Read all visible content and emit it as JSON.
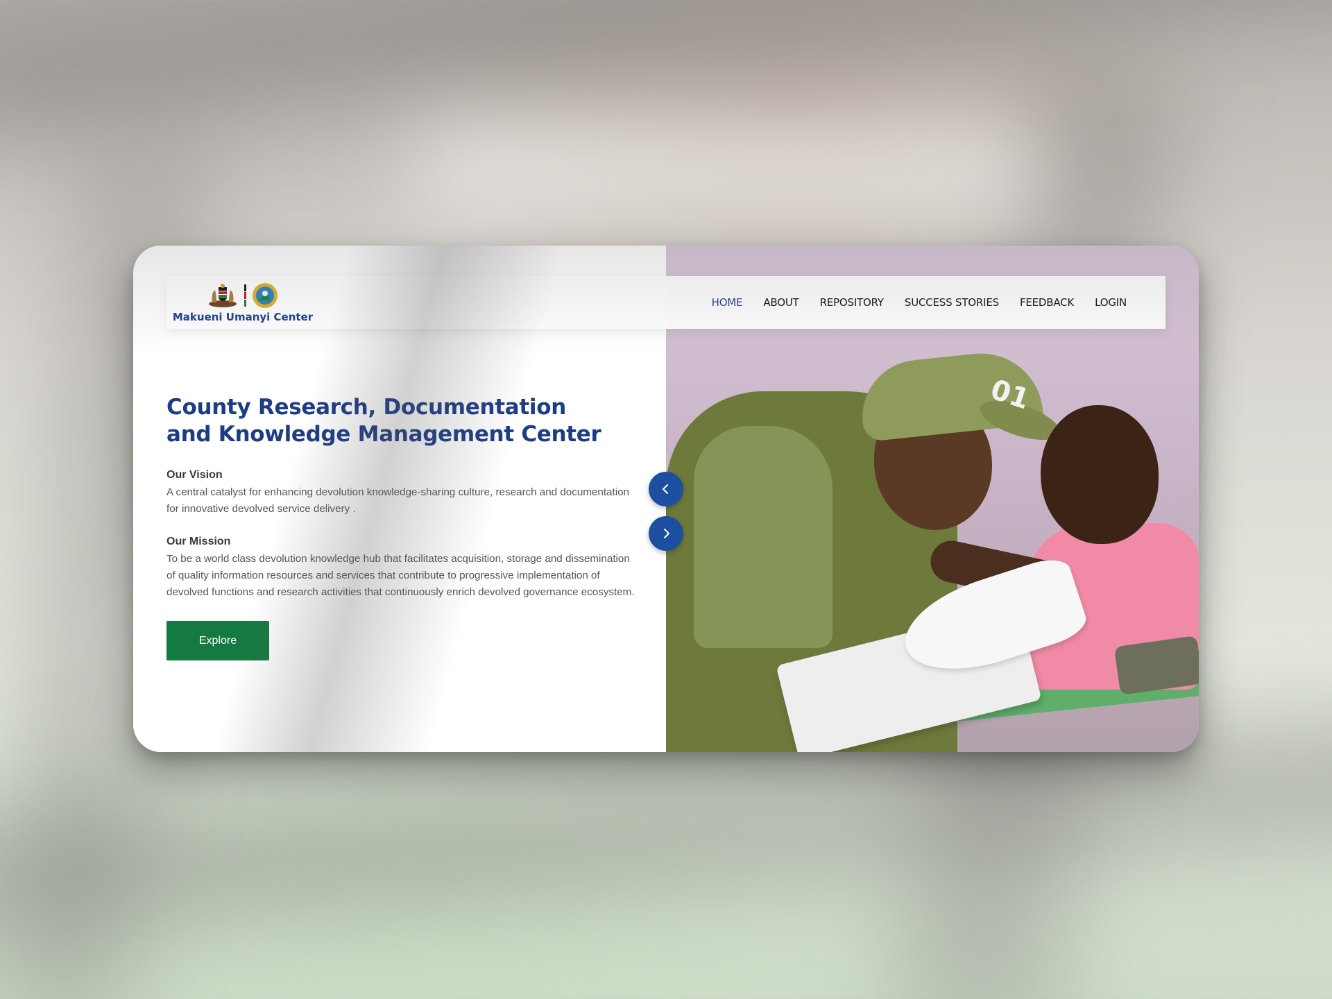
{
  "brand": {
    "name": "Makueni Umanyi Center",
    "emblems": [
      "kenya-coat-of-arms-icon",
      "makueni-county-seal-icon"
    ]
  },
  "nav": {
    "items": [
      {
        "label": "HOME",
        "active": true
      },
      {
        "label": "ABOUT",
        "active": false
      },
      {
        "label": "REPOSITORY",
        "active": false
      },
      {
        "label": "SUCCESS STORIES",
        "active": false
      },
      {
        "label": "FEEDBACK",
        "active": false
      },
      {
        "label": "LOGIN",
        "active": false
      }
    ]
  },
  "hero": {
    "title": "County Research, Documentation and Knowledge Management Center",
    "vision_label": "Our Vision",
    "vision_text": "A central catalyst for enhancing devolution knowledge-sharing culture, research and documentation for innovative devolved service delivery .",
    "mission_label": "Our Mission",
    "mission_text": "To be a world class devolution knowledge hub that facilitates acquisition, storage and dissemination of quality information resources and services that contribute to progressive implementation of devolved functions and research activities that continuously enrich devolved governance ecosystem.",
    "cta_label": "Explore",
    "photo_cap_text": "01"
  },
  "slider": {
    "prev_icon": "chevron-left-icon",
    "next_icon": "chevron-right-icon"
  },
  "colors": {
    "brand_blue": "#1c3c86",
    "cta_green": "#157a42",
    "arrow_blue": "#1d4fa0"
  }
}
